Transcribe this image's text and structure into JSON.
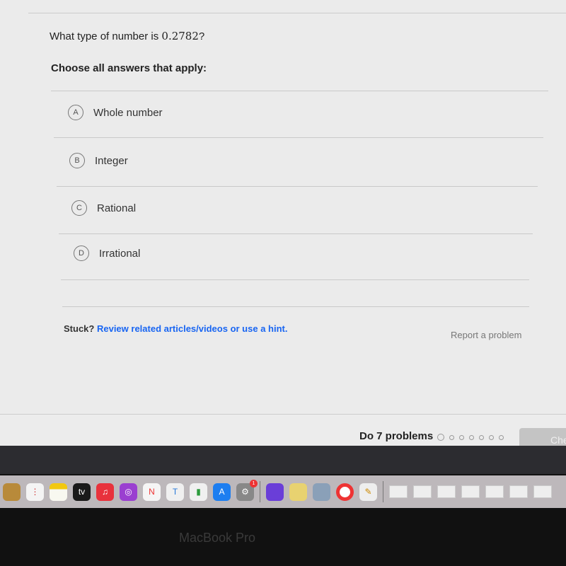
{
  "question": {
    "prefix": "What type of number is ",
    "number": "0.2782",
    "suffix": "?"
  },
  "instruction": "Choose all answers that apply:",
  "options": [
    {
      "letter": "A",
      "label": "Whole number"
    },
    {
      "letter": "B",
      "label": "Integer"
    },
    {
      "letter": "C",
      "label": "Rational"
    },
    {
      "letter": "D",
      "label": "Irrational"
    }
  ],
  "help": {
    "stuck": "Stuck?",
    "link": "Review related articles/videos or use a hint.",
    "report": "Report a problem"
  },
  "footer": {
    "task": "Do 7 problems",
    "progress_total": 7,
    "progress_done": 0,
    "check": "Che"
  },
  "dock": {
    "icons": [
      "contacts-icon",
      "reminders-icon",
      "notes-icon",
      "apple-tv-icon",
      "music-icon",
      "podcasts-icon",
      "news-icon",
      "keynote-icon",
      "numbers-icon",
      "app-store-icon",
      "system-preferences-icon",
      "app-icon",
      "stickies-icon",
      "preview-icon",
      "chrome-icon",
      "script-editor-icon"
    ],
    "tv": "tv",
    "badge": "1"
  },
  "bezel": "MacBook Pro"
}
